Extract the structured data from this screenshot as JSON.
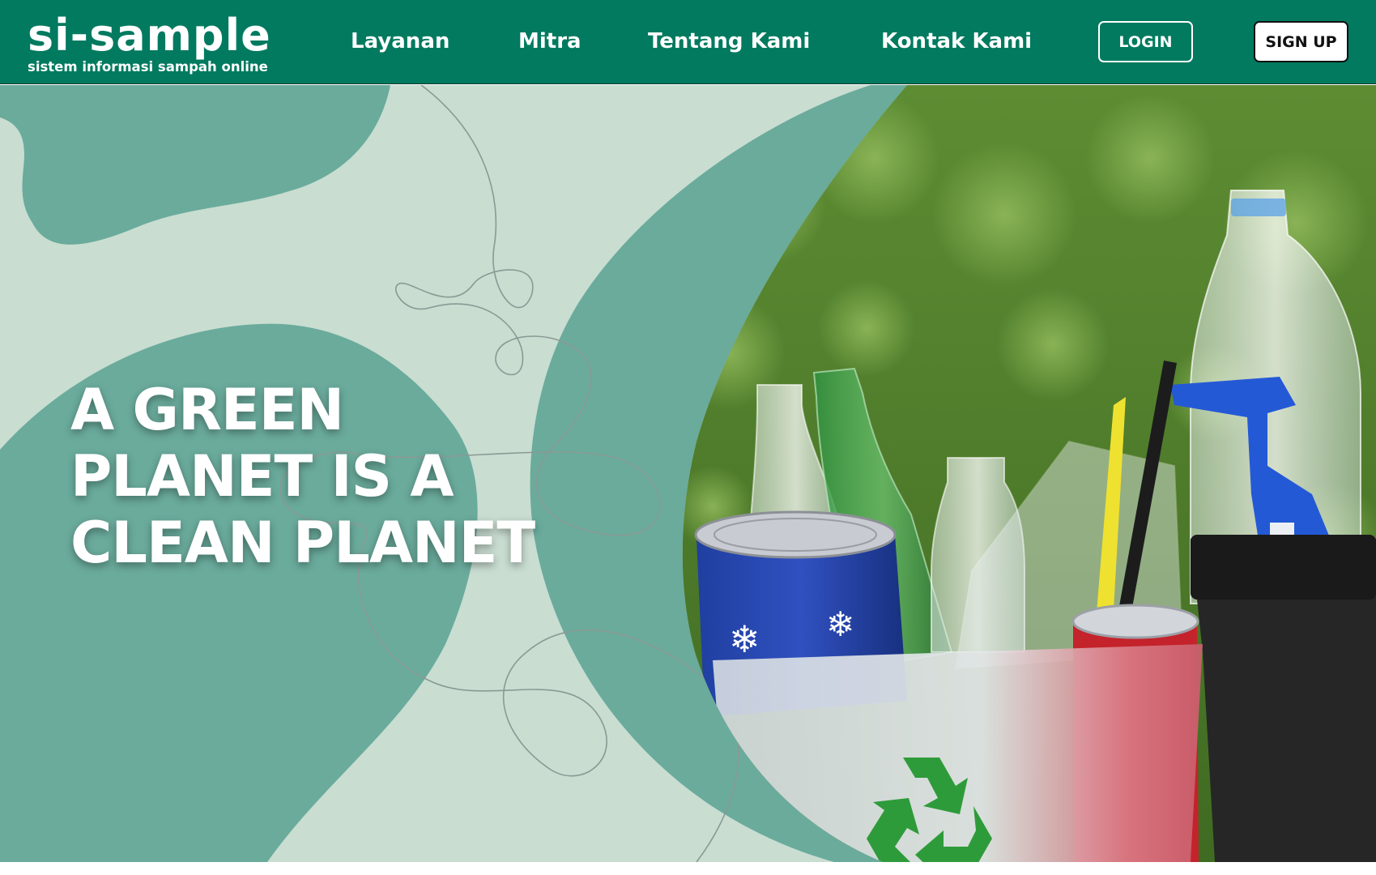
{
  "brand": {
    "name": "si-sample",
    "tagline": "sistem informasi sampah online"
  },
  "nav": {
    "links": [
      "Layanan",
      "Mitra",
      "Tentang Kami",
      "Kontak Kami"
    ],
    "login_label": "LOGIN",
    "signup_label": "SIGN UP"
  },
  "hero": {
    "title_lines": [
      "A GREEN",
      "PLANET IS A",
      "CLEAN PLANET"
    ]
  },
  "colors": {
    "primary": "#017a5f",
    "hero_background": "#c9ddd1",
    "blob": "#6aab9c",
    "foliage": "#5b8a33"
  },
  "icons": {
    "recycle": "recycle-icon"
  }
}
